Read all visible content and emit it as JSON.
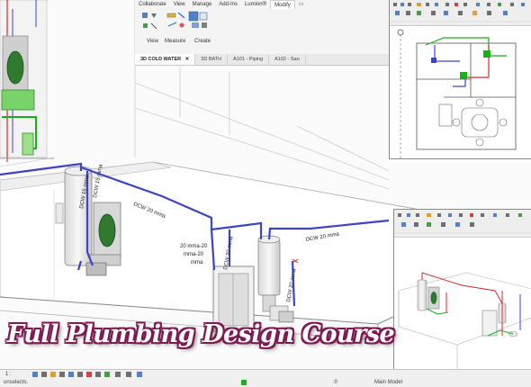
{
  "ribbon": {
    "tabs": [
      "Collaborate",
      "View",
      "Manage",
      "Add-Ins",
      "Lumion®",
      "Modify",
      "▭"
    ],
    "active_tab": "Modify",
    "groups": [
      "View",
      "Measure",
      "Create"
    ]
  },
  "view_tabs": [
    {
      "label": "3D COLD WATER",
      "close": "✕",
      "active": true
    },
    {
      "label": "3D BATH",
      "close": "",
      "active": false
    },
    {
      "label": "A101 - Piping",
      "close": "",
      "active": false
    },
    {
      "label": "A102 - San",
      "close": "",
      "active": false
    }
  ],
  "pipe_labels": {
    "run_top": "DCW 20 mma",
    "riser_left_a": "DCW 15 mma",
    "riser_left_b": "DCW 15 mma",
    "center_1": "20 mma-20",
    "center_2": "mma-20",
    "center_3": "mma",
    "riser_center": "DCW 20 mma",
    "run_right": "DCW 20 mma",
    "riser_right": "DCW 20 mma"
  },
  "course_title": "Full Plumbing Design Course",
  "status": {
    "scale": "1 : ",
    "message": "unselects.",
    "model": "Main Model",
    "filter_count": ":0"
  },
  "colors": {
    "cold_water": "#3d43c9",
    "plumbing_fixture_green": "#18b018",
    "annotation_red": "#d82a2a",
    "title_stroke": "#7d1a52"
  }
}
